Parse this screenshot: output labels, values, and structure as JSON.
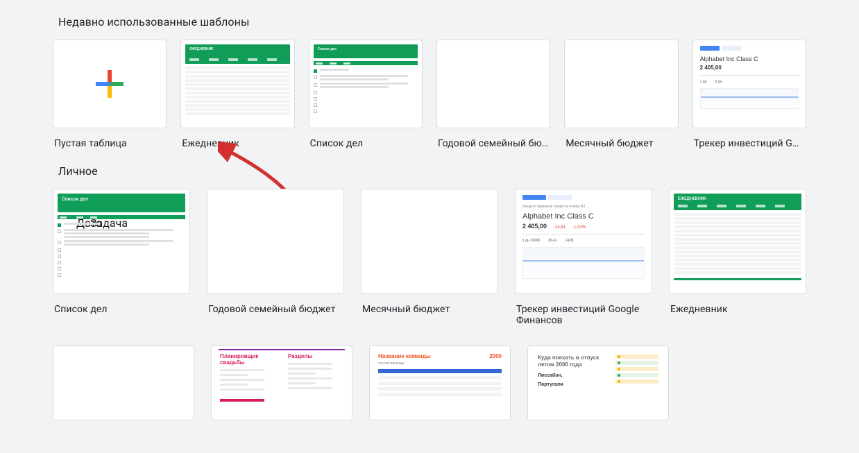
{
  "sections": {
    "recent_title": "Недавно использованные шаблоны",
    "personal_title": "Личное"
  },
  "recent": [
    {
      "label": "Пустая таблица",
      "kind": "blank-plus"
    },
    {
      "label": "Ежедневник",
      "kind": "planner-green"
    },
    {
      "label": "Список дел",
      "kind": "todo-green",
      "header_text": "Список дел"
    },
    {
      "label": "Годовой семейный бю…",
      "kind": "blank-white"
    },
    {
      "label": "Месячный бюджет",
      "kind": "blank-white"
    },
    {
      "label": "Трекер инвестиций G…",
      "kind": "stock",
      "stock_name": "Alphabet Inc Class C",
      "stock_price": "2 405,00"
    }
  ],
  "personal": [
    {
      "label": "Список дел",
      "kind": "todo-green-lg",
      "header_text": "Список дел"
    },
    {
      "label": "Годовой семейный бюджет",
      "kind": "blank-white"
    },
    {
      "label": "Месячный бюджет",
      "kind": "blank-white"
    },
    {
      "label": "Трекер инвестиций Google Финансов",
      "kind": "stock-lg",
      "stock_name": "Alphabet Inc Class C",
      "stock_price": "2 405,00",
      "stock_change": "-24,81",
      "stock_pct": "-1,02%"
    },
    {
      "label": "Ежедневник",
      "kind": "planner-green-lg",
      "header_text": "ЕЖЕДНЕВНИК"
    }
  ],
  "personal2": [
    {
      "kind": "blank-white"
    },
    {
      "kind": "wedding",
      "col1": "Планировщик свадьбы",
      "col2": "Разделы"
    },
    {
      "kind": "team",
      "title": "Название команды",
      "year": "2000",
      "sub": "состав команды"
    },
    {
      "kind": "travel",
      "title_l1": "Куда поехать в отпуск",
      "title_l2": "летом 2000 года",
      "dest1": "Лиссабон,",
      "dest2": "Португали"
    }
  ]
}
